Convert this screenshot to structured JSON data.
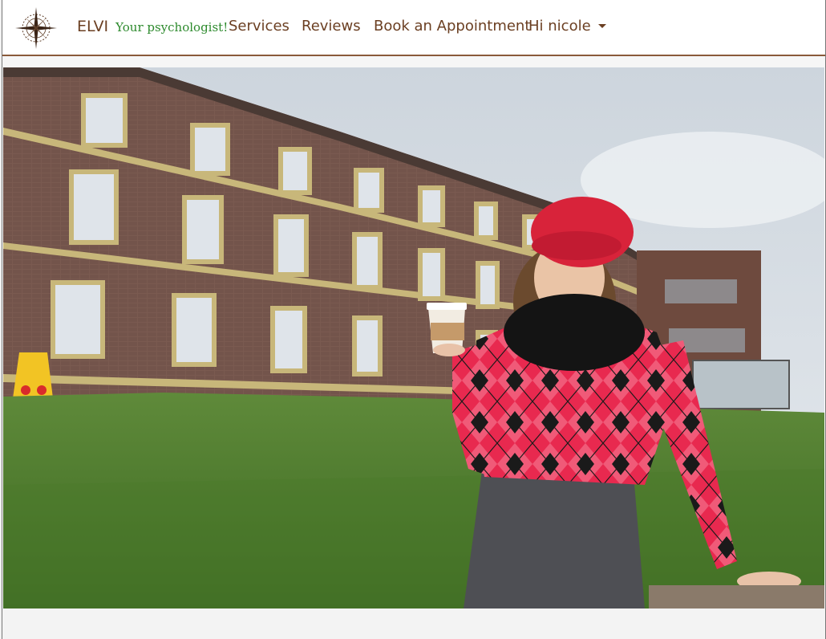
{
  "brand": {
    "name": "ELVI",
    "tagline": "Your psychologist!"
  },
  "nav": {
    "items": [
      {
        "label": "Services"
      },
      {
        "label": "Reviews"
      },
      {
        "label": "Book an Appointment"
      }
    ],
    "user_menu": {
      "label": "Hi nicole",
      "icon": "caret-down-icon"
    }
  },
  "hero": {
    "icon": "compass-rose-icon"
  },
  "colors": {
    "brand_brown": "#6b3f22",
    "tagline_green": "#2d8a2d",
    "navbar_border": "#8a5a3a"
  }
}
